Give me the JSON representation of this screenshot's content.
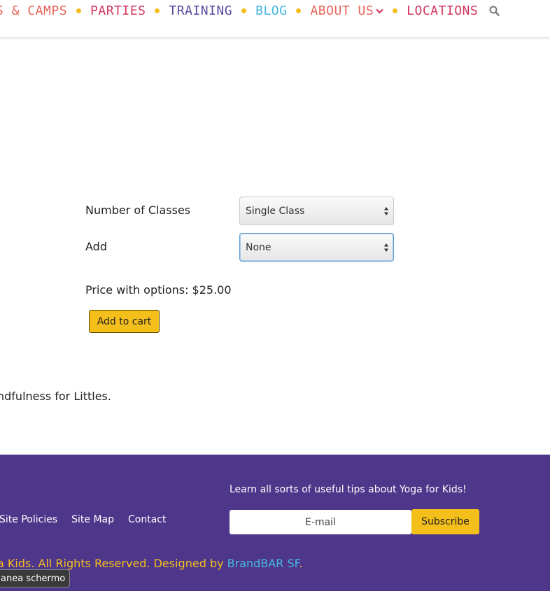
{
  "nav": {
    "items": [
      {
        "label": "S & CAMPS",
        "color": "#e8645a"
      },
      {
        "label": "PARTIES",
        "color": "#d4365c"
      },
      {
        "label": "TRAINING",
        "color": "#5a4aa0"
      },
      {
        "label": "BLOG",
        "color": "#47b8e0"
      },
      {
        "label": "ABOUT US",
        "color": "#e8645a"
      },
      {
        "label": "LOCATIONS",
        "color": "#d4365c"
      }
    ],
    "dot_color": "#f5bf1b",
    "search_icon": "search-icon"
  },
  "options": {
    "classes_label": "Number of Classes",
    "classes_value": "Single Class",
    "add_label": "Add",
    "add_value": "None"
  },
  "price_text": "Price with options: $25.00",
  "add_to_cart": "Add to cart",
  "mindful_text": "ndfulness for Littles.",
  "footer": {
    "tips": "Learn all sorts of useful tips about Yoga for Kids!",
    "links": [
      "Site Policies",
      "Site Map",
      "Contact"
    ],
    "email_placeholder": "E-mail",
    "subscribe": "Subscribe",
    "copyright_prefix": "a Kids. All Rights Reserved. Designed by ",
    "brand": "BrandBAR SF",
    "copyright_suffix": ".",
    "tooltip": "anea schermo",
    "bg_color": "#4e368b"
  }
}
